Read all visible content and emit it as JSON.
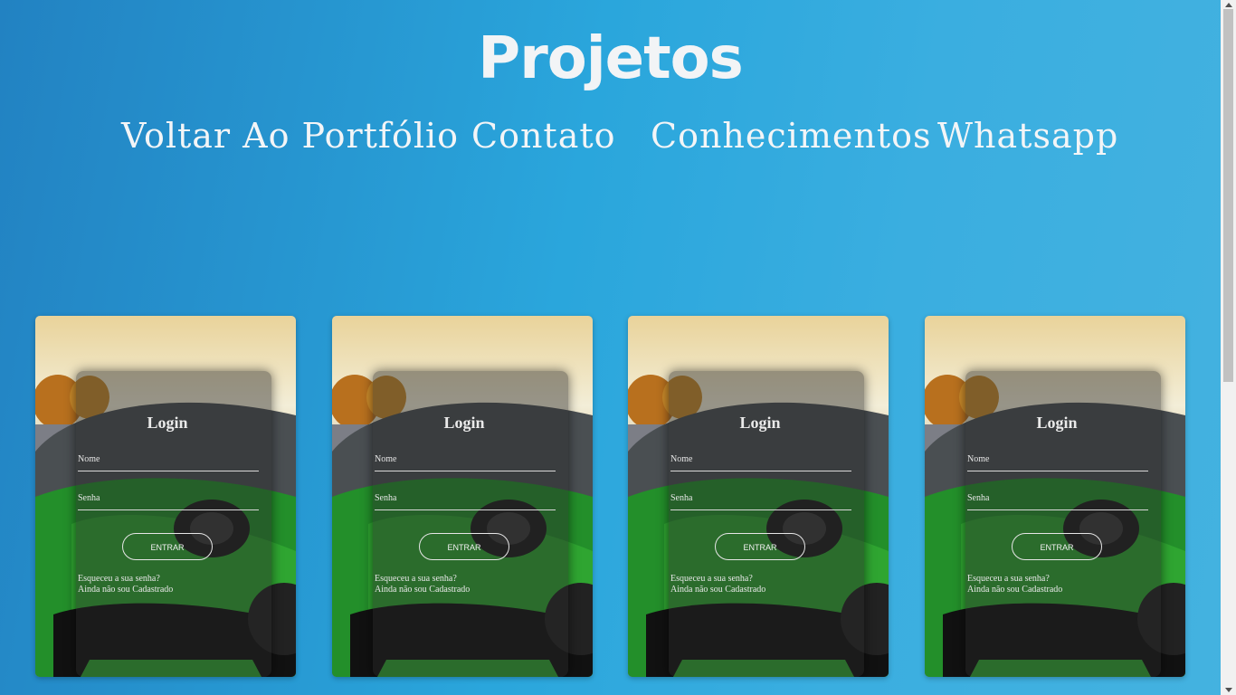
{
  "header": {
    "title": "Projetos"
  },
  "nav": {
    "items": [
      {
        "label": "Voltar Ao Portfólio"
      },
      {
        "label": "Contato"
      },
      {
        "label": "Conhecimentos"
      },
      {
        "label": "Whatsapp"
      }
    ]
  },
  "cards": [
    {
      "login_title": "Login",
      "name_placeholder": "Nome",
      "password_placeholder": "Senha",
      "enter_label": "ENTRAR",
      "forgot_link": "Esqueceu a sua senha?",
      "register_link": "Ainda não sou Cadastrado"
    },
    {
      "login_title": "Login",
      "name_placeholder": "Nome",
      "password_placeholder": "Senha",
      "enter_label": "ENTRAR",
      "forgot_link": "Esqueceu a sua senha?",
      "register_link": "Ainda não sou Cadastrado"
    },
    {
      "login_title": "Login",
      "name_placeholder": "Nome",
      "password_placeholder": "Senha",
      "enter_label": "ENTRAR",
      "forgot_link": "Esqueceu a sua senha?",
      "register_link": "Ainda não sou Cadastrado"
    },
    {
      "login_title": "Login",
      "name_placeholder": "Nome",
      "password_placeholder": "Senha",
      "enter_label": "ENTRAR",
      "forgot_link": "Esqueceu a sua senha?",
      "register_link": "Ainda não sou Cadastrado"
    }
  ],
  "colors": {
    "background_start": "#2282c2",
    "background_end": "#44b2e0",
    "text": "#f2f4f6",
    "car_green": "#2fa531"
  }
}
